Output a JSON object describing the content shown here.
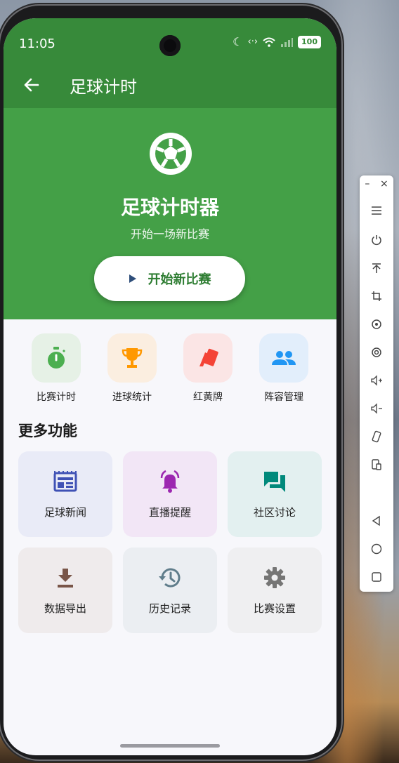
{
  "status": {
    "time": "11:05",
    "battery": "100"
  },
  "appbar": {
    "title": "足球计时"
  },
  "hero": {
    "title": "足球计时器",
    "subtitle": "开始一场新比赛",
    "start_button": "开始新比赛"
  },
  "quick_actions": [
    {
      "label": "比赛计时",
      "icon": "stopwatch-icon",
      "color": "#4caf50",
      "bg": "#e6f1e6"
    },
    {
      "label": "进球统计",
      "icon": "trophy-icon",
      "color": "#ff9800",
      "bg": "#fbeee0"
    },
    {
      "label": "红黄牌",
      "icon": "cards-icon",
      "color": "#f44336",
      "bg": "#fbe5e5"
    },
    {
      "label": "阵容管理",
      "icon": "people-icon",
      "color": "#2196f3",
      "bg": "#e2eefb"
    }
  ],
  "more": {
    "title": "更多功能",
    "cards": [
      {
        "label": "足球新闻",
        "icon": "newspaper-icon",
        "color": "#3f51b5",
        "bg": "#e9ebf7"
      },
      {
        "label": "直播提醒",
        "icon": "bell-icon",
        "color": "#9c27b0",
        "bg": "#f2e6f6"
      },
      {
        "label": "社区讨论",
        "icon": "forum-icon",
        "color": "#00897b",
        "bg": "#e3f0f0"
      },
      {
        "label": "数据导出",
        "icon": "download-icon",
        "color": "#795548",
        "bg": "#efebec"
      },
      {
        "label": "历史记录",
        "icon": "history-icon",
        "color": "#607d8b",
        "bg": "#ebeef2"
      },
      {
        "label": "比赛设置",
        "icon": "gear-icon",
        "color": "#757575",
        "bg": "#efeff1"
      }
    ]
  },
  "colors": {
    "primary_dark": "#378a3a",
    "primary": "#44a047"
  }
}
